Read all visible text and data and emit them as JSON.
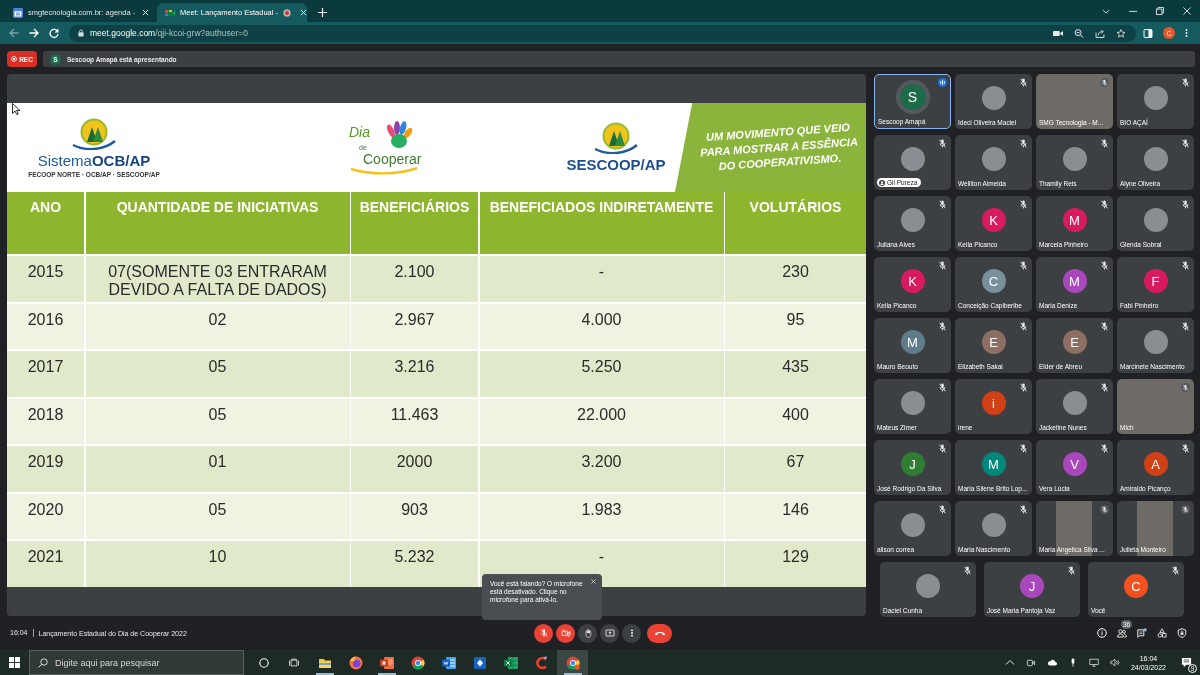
{
  "browser": {
    "tabs": [
      {
        "title": "smgtecnologia.com.br: agenda -",
        "kind": "calendar",
        "recording": false,
        "selected": false
      },
      {
        "title": "Meet: Lançamento Estadual -",
        "kind": "meet",
        "recording": true,
        "selected": true
      }
    ],
    "url_host": "meet.google.com",
    "url_path": "/qji-kcoi-grw?authuser=0",
    "profile_initial": "C"
  },
  "meet": {
    "recording_label": "REC",
    "presenter_initial": "S",
    "presenter_text": "Sescoop Amapá está apresentando",
    "slide": {
      "logo_left": {
        "name": "Sistema**OCB/AP**",
        "subtitle": "FECOOP NORTE · OCB/AP · SESCOOP/AP"
      },
      "logo_center": [
        "Dia",
        "de",
        "Cooperar"
      ],
      "logo_right": {
        "name": "SESCOOP/AP"
      },
      "banner": "UM MOVIMENTO QUE VEIO PARA MOSTRAR A ESSÊNCIA DO COOPERATIVISMO.",
      "table": {
        "columns": [
          "ANO",
          "QUANTIDADE DE INICIATIVAS",
          "BENEFICIÁRIOS",
          "BENEFICIADOS INDIRETAMENTE",
          "VOLUTÁRIOS"
        ],
        "rows": [
          [
            "2015",
            "07(SOMENTE 03 ENTRARAM DEVIDO A FALTA DE DADOS)",
            "2.100",
            "-",
            "230"
          ],
          [
            "2016",
            "02",
            "2.967",
            "4.000",
            "95"
          ],
          [
            "2017",
            "05",
            "3.216",
            "5.250",
            "435"
          ],
          [
            "2018",
            "05",
            "11.463",
            "22.000",
            "400"
          ],
          [
            "2019",
            "01",
            "2000",
            "3.200",
            "67"
          ],
          [
            "2020",
            "05",
            "903",
            "1.983",
            "146"
          ],
          [
            "2021",
            "10",
            "5.232",
            "-",
            "129"
          ]
        ]
      }
    },
    "participants": [
      {
        "name": "Sescoop Amapá",
        "kind": "initial",
        "initial": "S",
        "color": "#1e6b4a",
        "speaking": true,
        "muted": false,
        "name_pill": false
      },
      {
        "name": "Ideci Oliveira Maciel",
        "kind": "photo",
        "speaking": false,
        "muted": true,
        "name_pill": false
      },
      {
        "name": "SMG Tecnologia - M...",
        "kind": "video",
        "speaking": false,
        "muted": true,
        "name_pill": false
      },
      {
        "name": "BIO AÇAÍ",
        "kind": "photo",
        "speaking": false,
        "muted": true,
        "name_pill": false
      },
      {
        "name": "Gil Pureza",
        "kind": "photo",
        "speaking": false,
        "muted": true,
        "name_pill": true
      },
      {
        "name": "Welliton Almeida",
        "kind": "photo",
        "speaking": false,
        "muted": true,
        "name_pill": false
      },
      {
        "name": "Thamily Reis",
        "kind": "photo",
        "speaking": false,
        "muted": true,
        "name_pill": false
      },
      {
        "name": "Alyne Oliveira",
        "kind": "photo",
        "speaking": false,
        "muted": true,
        "name_pill": false
      },
      {
        "name": "Juliana Alves",
        "kind": "photo",
        "speaking": false,
        "muted": true,
        "name_pill": false
      },
      {
        "name": "Keila Picanco",
        "kind": "initial",
        "initial": "K",
        "color": "#d81b60",
        "speaking": false,
        "muted": true,
        "name_pill": false
      },
      {
        "name": "Marcela Pinheiro",
        "kind": "initial",
        "initial": "M",
        "color": "#d81b60",
        "speaking": false,
        "muted": true,
        "name_pill": false
      },
      {
        "name": "Glenda Sobral",
        "kind": "photo",
        "speaking": false,
        "muted": true,
        "name_pill": false
      },
      {
        "name": "Keila Picanco",
        "kind": "initial",
        "initial": "K",
        "color": "#d81b60",
        "speaking": false,
        "muted": true,
        "name_pill": false
      },
      {
        "name": "Conceição Capiberibe",
        "kind": "initial",
        "initial": "C",
        "color": "#78909c",
        "speaking": false,
        "muted": true,
        "name_pill": false
      },
      {
        "name": "Maria Denize",
        "kind": "initial",
        "initial": "M",
        "color": "#ab47bc",
        "speaking": false,
        "muted": true,
        "name_pill": false
      },
      {
        "name": "Fabi Pinheiro",
        "kind": "initial",
        "initial": "F",
        "color": "#d81b60",
        "speaking": false,
        "muted": true,
        "name_pill": false
      },
      {
        "name": "Mauro Beouto",
        "kind": "initial",
        "initial": "M",
        "color": "#5f7c8a",
        "speaking": false,
        "muted": true,
        "name_pill": false
      },
      {
        "name": "Elizabeth Sakai",
        "kind": "initial",
        "initial": "E",
        "color": "#8d6e63",
        "speaking": false,
        "muted": true,
        "name_pill": false
      },
      {
        "name": "Elder de Abreu",
        "kind": "initial",
        "initial": "E",
        "color": "#8d6e63",
        "speaking": false,
        "muted": true,
        "name_pill": false
      },
      {
        "name": "Marcinete Nascimento",
        "kind": "photo",
        "speaking": false,
        "muted": true,
        "name_pill": false
      },
      {
        "name": "Mateus Zimer",
        "kind": "photo",
        "speaking": false,
        "muted": true,
        "name_pill": false
      },
      {
        "name": "irene",
        "kind": "initial",
        "initial": "i",
        "color": "#d13f15",
        "speaking": false,
        "muted": true,
        "name_pill": false
      },
      {
        "name": "Jackeline Nunes",
        "kind": "photo",
        "speaking": false,
        "muted": true,
        "name_pill": false
      },
      {
        "name": "Mich",
        "kind": "video",
        "speaking": false,
        "muted": true,
        "name_pill": false
      },
      {
        "name": "José Rodrigo Da Silva",
        "kind": "initial",
        "initial": "J",
        "color": "#2e7d32",
        "speaking": false,
        "muted": true,
        "name_pill": false
      },
      {
        "name": "Maria Silene Brito Lop...",
        "kind": "initial",
        "initial": "M",
        "color": "#00897b",
        "speaking": false,
        "muted": true,
        "name_pill": false
      },
      {
        "name": "Vera Lúcia",
        "kind": "initial",
        "initial": "V",
        "color": "#ab47bc",
        "speaking": false,
        "muted": true,
        "name_pill": false
      },
      {
        "name": "Amiraldo Picanço",
        "kind": "initial",
        "initial": "A",
        "color": "#d13f15",
        "speaking": false,
        "muted": true,
        "name_pill": false
      },
      {
        "name": "alison correa",
        "kind": "photo",
        "speaking": false,
        "muted": true,
        "name_pill": false
      },
      {
        "name": "Maria Nascimento",
        "kind": "photo",
        "speaking": false,
        "muted": true,
        "name_pill": false
      },
      {
        "name": "Maria Angelica Silva ...",
        "kind": "portrait-video",
        "speaking": false,
        "muted": true,
        "name_pill": false
      },
      {
        "name": "Julieta Monteiro",
        "kind": "portrait-video",
        "speaking": false,
        "muted": true,
        "name_pill": false
      }
    ],
    "participants_last_row": [
      {
        "name": "Daciel Cunha",
        "kind": "photo",
        "speaking": false,
        "muted": true,
        "name_pill": false
      },
      {
        "name": "José Maria Pantoja Vaz",
        "kind": "initial",
        "initial": "J",
        "color": "#ab47bc",
        "speaking": false,
        "muted": true,
        "name_pill": false
      },
      {
        "name": "Você",
        "kind": "initial",
        "initial": "C",
        "color": "#f4511e",
        "speaking": false,
        "muted": true,
        "name_pill": false
      }
    ],
    "tooltip": "Você está falando? O microfone está desativado. Clique no microfone para ativá-lo.",
    "footer": {
      "time": "16:04",
      "title": "Lançamento Estadual do Dia de Cooperar 2022",
      "mic_on": false,
      "camera_on": false,
      "people_count": "36",
      "chat_unread": true
    }
  },
  "taskbar": {
    "search_placeholder": "Digite aqui para pesquisar",
    "apps": [
      {
        "kind": "explorer",
        "running": true,
        "selected": false
      },
      {
        "kind": "firefox",
        "running": false,
        "selected": false
      },
      {
        "kind": "powerpoint",
        "running": true,
        "selected": false
      },
      {
        "kind": "chrome",
        "running": false,
        "selected": false
      },
      {
        "kind": "word",
        "running": false,
        "selected": false
      },
      {
        "kind": "blue-app",
        "running": false,
        "selected": false
      },
      {
        "kind": "excel",
        "running": false,
        "selected": false
      },
      {
        "kind": "ccleaner",
        "running": false,
        "selected": false
      },
      {
        "kind": "chrome-profile",
        "running": true,
        "selected": true
      }
    ],
    "time": "16:04",
    "date": "24/03/2022",
    "notifications": "9"
  }
}
